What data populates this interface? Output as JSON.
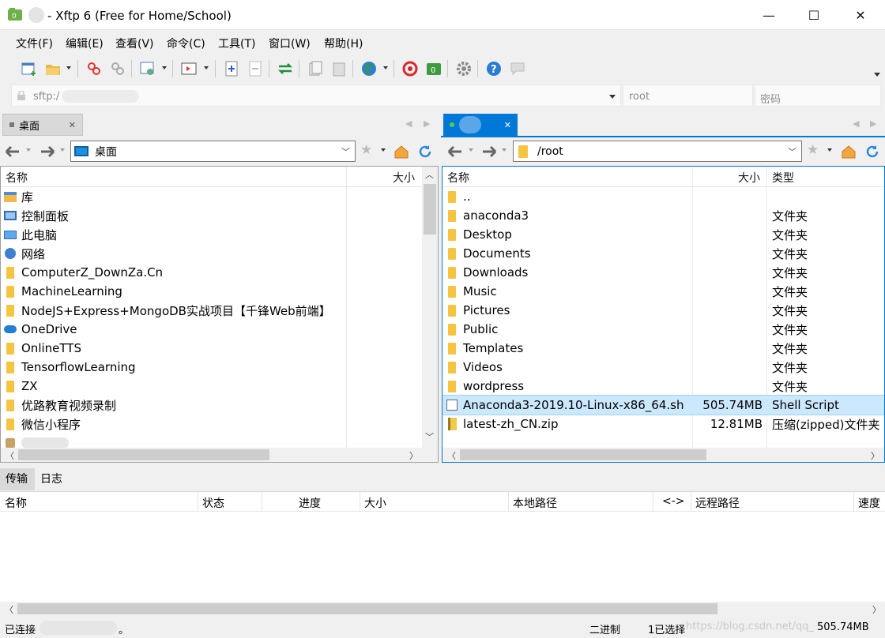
{
  "window": {
    "title": "Xftp 6 (Free for Home/School)",
    "title_prefix": "- ",
    "controls": {
      "minimize": "—",
      "maximize": "☐",
      "close": "✕"
    }
  },
  "menu": [
    "文件(F)",
    "编辑(E)",
    "查看(V)",
    "命令(C)",
    "工具(T)",
    "窗口(W)",
    "帮助(H)"
  ],
  "address": {
    "url": "sftp:/",
    "user": "root",
    "password_placeholder": "密码"
  },
  "left": {
    "tab_label": "桌面",
    "path": "桌面",
    "columns": {
      "name": "名称",
      "size": "大小"
    },
    "items": [
      {
        "name": "库",
        "icon": "library-icon"
      },
      {
        "name": "控制面板",
        "icon": "control-panel-icon"
      },
      {
        "name": "此电脑",
        "icon": "computer-icon"
      },
      {
        "name": "网络",
        "icon": "network-icon"
      },
      {
        "name": "ComputerZ_DownZa.Cn",
        "icon": "folder-icon"
      },
      {
        "name": "MachineLearning",
        "icon": "folder-icon"
      },
      {
        "name": "NodeJS+Express+MongoDB实战项目【千锋Web前端】",
        "icon": "folder-icon"
      },
      {
        "name": "OneDrive",
        "icon": "cloud-icon"
      },
      {
        "name": "OnlineTTS",
        "icon": "folder-icon"
      },
      {
        "name": "TensorflowLearning",
        "icon": "folder-icon"
      },
      {
        "name": "ZX",
        "icon": "folder-icon"
      },
      {
        "name": "优路教育视频录制",
        "icon": "folder-icon"
      },
      {
        "name": "微信小程序",
        "icon": "folder-icon"
      }
    ]
  },
  "right": {
    "path": "/root",
    "columns": {
      "name": "名称",
      "size": "大小",
      "type": "类型"
    },
    "items": [
      {
        "name": "..",
        "size": "",
        "type": "",
        "icon": "folder-icon"
      },
      {
        "name": "anaconda3",
        "size": "",
        "type": "文件夹",
        "icon": "folder-icon"
      },
      {
        "name": "Desktop",
        "size": "",
        "type": "文件夹",
        "icon": "folder-icon"
      },
      {
        "name": "Documents",
        "size": "",
        "type": "文件夹",
        "icon": "folder-icon"
      },
      {
        "name": "Downloads",
        "size": "",
        "type": "文件夹",
        "icon": "folder-icon"
      },
      {
        "name": "Music",
        "size": "",
        "type": "文件夹",
        "icon": "folder-icon"
      },
      {
        "name": "Pictures",
        "size": "",
        "type": "文件夹",
        "icon": "folder-icon"
      },
      {
        "name": "Public",
        "size": "",
        "type": "文件夹",
        "icon": "folder-icon"
      },
      {
        "name": "Templates",
        "size": "",
        "type": "文件夹",
        "icon": "folder-icon"
      },
      {
        "name": "Videos",
        "size": "",
        "type": "文件夹",
        "icon": "folder-icon"
      },
      {
        "name": "wordpress",
        "size": "",
        "type": "文件夹",
        "icon": "folder-icon"
      },
      {
        "name": "Anaconda3-2019.10-Linux-x86_64.sh",
        "size": "505.74MB",
        "type": "Shell Script",
        "icon": "script-icon",
        "selected": true
      },
      {
        "name": "latest-zh_CN.zip",
        "size": "12.81MB",
        "type": "压缩(zipped)文件夹",
        "icon": "zip-icon"
      }
    ]
  },
  "bottom_tabs": [
    "传输",
    "日志"
  ],
  "transfer_columns": [
    "名称",
    "状态",
    "进度",
    "大小",
    "本地路径",
    "<->",
    "远程路径",
    "速度"
  ],
  "status": {
    "connection": "已连接",
    "connection_suffix": "。",
    "mode": "二进制",
    "selection": "1已选择",
    "size": "505.74MB",
    "watermark": "https://blog.csdn.net/qq_"
  },
  "colors": {
    "accent": "#0078d7",
    "selected_row": "#cce8ff",
    "folder": "#f5c542"
  }
}
